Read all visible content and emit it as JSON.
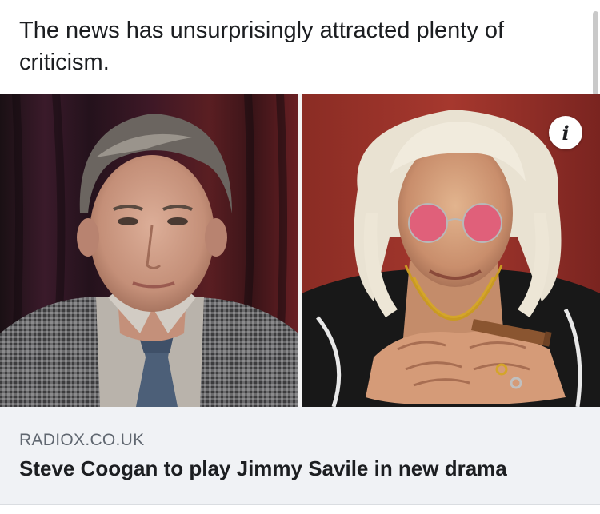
{
  "post": {
    "text": "The news has unsurprisingly attracted plenty of criticism."
  },
  "link_card": {
    "info_button_glyph": "i",
    "domain": "RADIOX.CO.UK",
    "headline": "Steve Coogan to play Jimmy Savile in new drama"
  },
  "colors": {
    "footer_background": "#f0f2f5",
    "domain_text": "#606770",
    "headline_text": "#1c1e21"
  }
}
